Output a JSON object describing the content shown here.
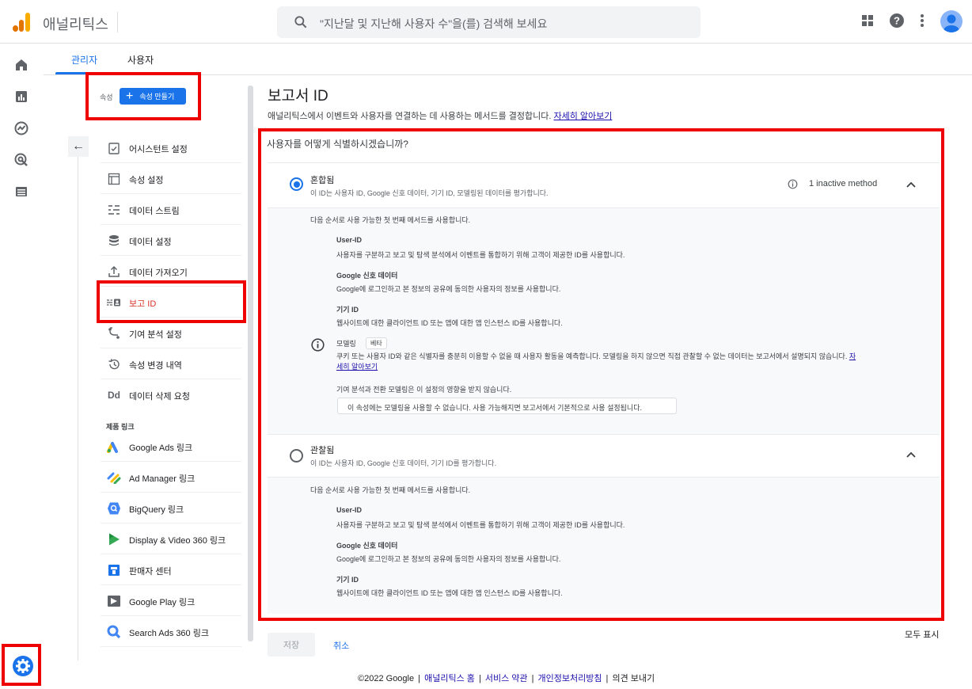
{
  "header": {
    "app_name": "애널리틱스",
    "search_placeholder": "\"지난달 및 지난해 사용자 수\"을(를) 검색해 보세요",
    "accent": "#1a73e8",
    "logo_colors": [
      "#f9ab00",
      "#e37400",
      "#e37400"
    ]
  },
  "rail": {
    "icons": [
      "home-icon",
      "reports-icon",
      "explore-icon",
      "advertising-icon",
      "configure-icon"
    ],
    "settings_icon": "gear-icon"
  },
  "tabs": [
    {
      "label": "관리자",
      "active": true
    },
    {
      "label": "사용자",
      "active": false
    }
  ],
  "property": {
    "label": "속성",
    "create_button": "속성 만들기"
  },
  "nav": {
    "items": [
      {
        "label": "어시스턴트 설정",
        "icon": "checklist-icon"
      },
      {
        "label": "속성 설정",
        "icon": "property-settings-icon"
      },
      {
        "label": "데이터 스트림",
        "icon": "data-streams-icon"
      },
      {
        "label": "데이터 설정",
        "icon": "database-icon"
      },
      {
        "label": "데이터 가져오기",
        "icon": "upload-icon"
      },
      {
        "label": "보고 ID",
        "icon": "reporting-identity-icon",
        "active": true
      },
      {
        "label": "기여 분석 설정",
        "icon": "attribution-icon"
      },
      {
        "label": "속성 변경 내역",
        "icon": "history-icon"
      },
      {
        "label": "데이터 삭제 요청",
        "icon": "data-deletion-icon"
      }
    ],
    "product_links_heading": "제품 링크",
    "product_links": [
      {
        "label": "Google Ads 링크",
        "icon": "google-ads-icon"
      },
      {
        "label": "Ad Manager 링크",
        "icon": "ad-manager-icon"
      },
      {
        "label": "BigQuery 링크",
        "icon": "bigquery-icon"
      },
      {
        "label": "Display & Video 360 링크",
        "icon": "display-video-360-icon"
      },
      {
        "label": "판매자 센터",
        "icon": "merchant-center-icon"
      },
      {
        "label": "Google Play 링크",
        "icon": "google-play-icon"
      },
      {
        "label": "Search Ads 360 링크",
        "icon": "search-ads-360-icon"
      }
    ]
  },
  "main": {
    "title": "보고서 ID",
    "description": "애널리틱스에서 이벤트와 사용자를 연결하는 데 사용하는 메서드를 결정합니다.",
    "learn_more": "자세히 알아보기",
    "question": "사용자를 어떻게 식별하시겠습니까?",
    "options": [
      {
        "title": "혼합됨",
        "description": "이 ID는 사용자 ID, Google 신호 데이터, 기기 ID, 모델링된 데이터를 평가합니다.",
        "selected": true,
        "inactive_note": "1 inactive method",
        "intro": "다음 순서로 사용 가능한 첫 번째 메서드를 사용합니다.",
        "methods": [
          {
            "title": "User-ID",
            "description": "사용자를 구분하고 보고 및 탐색 분석에서 이벤트를 통합하기 위해 고객이 제공한 ID를 사용합니다."
          },
          {
            "title": "Google 신호 데이터",
            "description": "Google에 로그인하고 본 정보의 공유에 동의한 사용자의 정보를 사용합니다."
          },
          {
            "title": "기기 ID",
            "description": "웹사이트에 대한 클라이언트 ID 또는 앱에 대한 앱 인스턴스 ID를 사용합니다."
          }
        ],
        "modeling": {
          "title": "모델링",
          "badge": "베타",
          "description_1": "쿠키 또는 사용자 ID와 같은 식별자를 충분히 이용할 수 없을 때 사용자 활동을 예측합니다. 모델링을 하지 않으면 직접 관찰할 수 없는 데이터는 보고서에서 설명되지 않습니다.",
          "learn_more_1": "자",
          "learn_more_2": "세히 알아보기",
          "footnote": "기여 분석과 전환 모델링은 이 설정의 영향을 받지 않습니다.",
          "notice": "이 속성에는 모델링을 사용할 수 없습니다. 사용 가능해지면 보고서에서 기본적으로 사용 설정됩니다."
        }
      },
      {
        "title": "관찰됨",
        "description": "이 ID는 사용자 ID, Google 신호 데이터, 기기 ID를 평가합니다.",
        "selected": false,
        "intro": "다음 순서로 사용 가능한 첫 번째 메서드를 사용합니다.",
        "methods": [
          {
            "title": "User-ID",
            "description": "사용자를 구분하고 보고 및 탐색 분석에서 이벤트를 통합하기 위해 고객이 제공한 ID를 사용합니다."
          },
          {
            "title": "Google 신호 데이터",
            "description": "Google에 로그인하고 본 정보의 공유에 동의한 사용자의 정보를 사용합니다."
          },
          {
            "title": "기기 ID",
            "description": "웹사이트에 대한 클라이언트 ID 또는 앱에 대한 앱 인스턴스 ID를 사용합니다."
          }
        ]
      }
    ],
    "save_label": "저장",
    "cancel_label": "취소",
    "show_all": "모두 표시"
  },
  "footer": {
    "copyright": "©2022 Google",
    "links": [
      "애널리틱스 홈",
      "서비스 약관",
      "개인정보처리방침"
    ],
    "feedback": "의견 보내기"
  }
}
